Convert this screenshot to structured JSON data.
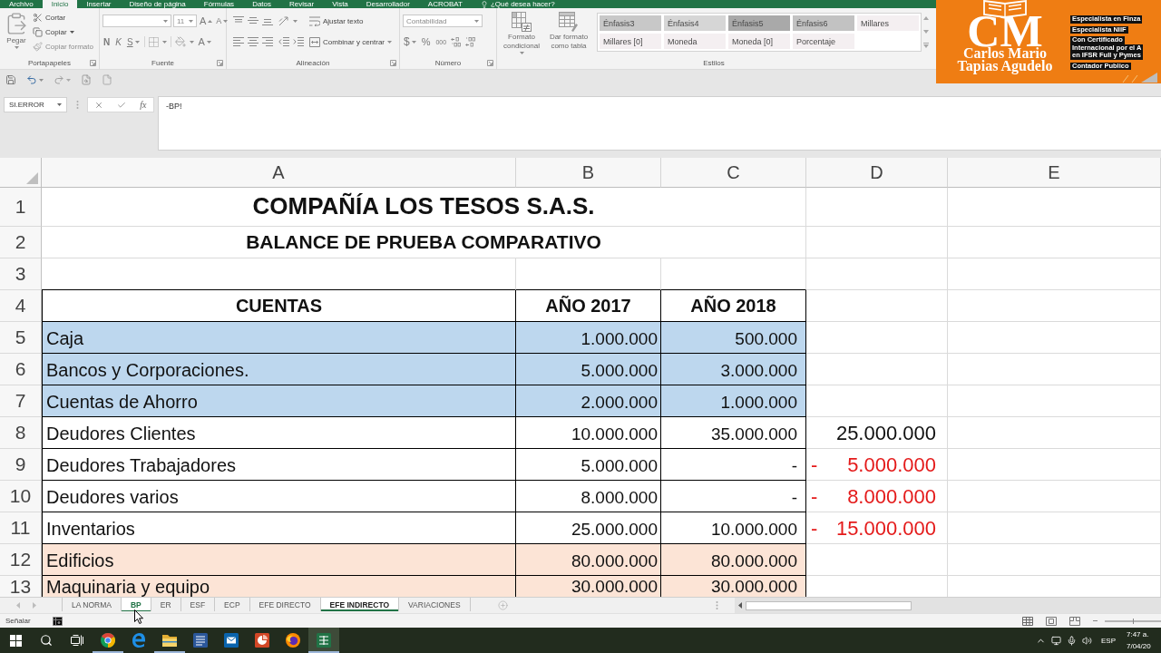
{
  "ribbon": {
    "tabs": [
      {
        "label": "Archivo",
        "selected": false
      },
      {
        "label": "Inicio",
        "selected": true
      },
      {
        "label": "Insertar",
        "selected": false
      },
      {
        "label": "Diseño de página",
        "selected": false
      },
      {
        "label": "Fórmulas",
        "selected": false
      },
      {
        "label": "Datos",
        "selected": false
      },
      {
        "label": "Revisar",
        "selected": false
      },
      {
        "label": "Vista",
        "selected": false
      },
      {
        "label": "Desarrollador",
        "selected": false
      },
      {
        "label": "ACROBAT",
        "selected": false
      }
    ],
    "tell_me": "¿Qué desea hacer?",
    "clipboard": {
      "label": "Portapapeles",
      "paste": "Pegar",
      "cut": "Cortar",
      "copy": "Copiar",
      "format_painter": "Copiar formato"
    },
    "font": {
      "label": "Fuente",
      "size": "11",
      "grow": "A",
      "shrink": "A",
      "bold": "N",
      "italic": "K",
      "underline": "S",
      "font_color": "A"
    },
    "alignment": {
      "label": "Alineación",
      "wrap_text": "Ajustar texto",
      "merge": "Combinar y centrar"
    },
    "number": {
      "label": "Número",
      "format": "Contabilidad",
      "currency": "$",
      "percent": "%",
      "thousands": "000"
    },
    "styles": {
      "label": "Estilos",
      "conditional_format": "Formato condicional",
      "format_as_table": "Dar formato como tabla",
      "gallery": [
        {
          "label": "Énfasis3",
          "color": "#c8c8c8"
        },
        {
          "label": "Énfasis4",
          "color": "#d6d6d6"
        },
        {
          "label": "Énfasis5",
          "color": "#a9a9a9"
        },
        {
          "label": "Énfasis6",
          "color": "#c2c2c2"
        },
        {
          "label": "Millares",
          "color": "#f4eff1"
        },
        {
          "label": "Millares [0]",
          "color": "#f4eff1"
        },
        {
          "label": "Moneda",
          "color": "#f4eff1"
        },
        {
          "label": "Moneda [0]",
          "color": "#f4eff1"
        },
        {
          "label": "Porcentaje",
          "color": "#f4eff1"
        }
      ]
    }
  },
  "brand": {
    "monogram": "CM",
    "name": [
      "Carlos Mario",
      "Tapias Agudelo"
    ],
    "badges": [
      {
        "lines": [
          "Especialista en Finza"
        ]
      },
      {
        "lines": [
          "Especialista NIIF"
        ]
      },
      {
        "lines": [
          "Con Certificado",
          "Internacional por el A",
          "en IFSR Full y Pymes"
        ]
      },
      {
        "lines": [
          "Contador Publico"
        ]
      }
    ]
  },
  "formula_bar": {
    "name_box": "SI.ERROR",
    "insert_function": "fx",
    "formula": "-BP!"
  },
  "sheet": {
    "columns": [
      "A",
      "B",
      "C",
      "D",
      "E"
    ],
    "rows": [
      {
        "number": "1",
        "kind": "title",
        "text": "COMPAÑÍA LOS TESOS S.A.S."
      },
      {
        "number": "2",
        "kind": "subtitle",
        "text": "BALANCE DE PRUEBA COMPARATIVO"
      },
      {
        "number": "3",
        "kind": "blank"
      },
      {
        "number": "4",
        "kind": "header",
        "cells": [
          "CUENTAS",
          "AÑO 2017",
          "AÑO 2018"
        ]
      },
      {
        "number": "5",
        "kind": "account",
        "color": "#bdd7ee",
        "account": "Caja",
        "year_2017": "1.000.000",
        "year_2018": "500.000"
      },
      {
        "number": "6",
        "kind": "account",
        "color": "#bdd7ee",
        "account": "Bancos y Corporaciones.",
        "year_2017": "5.000.000",
        "year_2018": "3.000.000"
      },
      {
        "number": "7",
        "kind": "account",
        "color": "#bdd7ee",
        "account": "Cuentas de Ahorro",
        "year_2017": "2.000.000",
        "year_2018": "1.000.000"
      },
      {
        "number": "8",
        "kind": "account",
        "account": "Deudores Clientes",
        "year_2017": "10.000.000",
        "year_2018": "35.000.000",
        "difference": {
          "value": "25.000.000",
          "negative": false
        }
      },
      {
        "number": "9",
        "kind": "account",
        "account": "Deudores Trabajadores",
        "year_2017": "5.000.000",
        "year_2018": "-",
        "difference": {
          "sign": "-",
          "value": "5.000.000",
          "negative": true
        }
      },
      {
        "number": "10",
        "kind": "account",
        "account": "Deudores varios",
        "year_2017": "8.000.000",
        "year_2018": "-",
        "difference": {
          "sign": "-",
          "value": "8.000.000",
          "negative": true
        }
      },
      {
        "number": "11",
        "kind": "account",
        "account": "Inventarios",
        "year_2017": "25.000.000",
        "year_2018": "10.000.000",
        "difference": {
          "sign": "-",
          "value": "15.000.000",
          "negative": true
        }
      },
      {
        "number": "12",
        "kind": "account",
        "color": "#fce4d6",
        "account": "Edificios",
        "year_2017": "80.000.000",
        "year_2018": "80.000.000"
      },
      {
        "number": "13",
        "kind": "account",
        "color": "#fce4d6",
        "account": "Maquinaria y equipo",
        "year_2017": "30.000.000",
        "year_2018": "30.000.000"
      }
    ]
  },
  "sheet_tabs": [
    {
      "label": "LA NORMA",
      "selected": false,
      "formula_origin": false
    },
    {
      "label": "BP",
      "selected": true,
      "formula_origin": false
    },
    {
      "label": "ER",
      "selected": false,
      "formula_origin": false
    },
    {
      "label": "ESF",
      "selected": false,
      "formula_origin": false
    },
    {
      "label": "ECP",
      "selected": false,
      "formula_origin": false
    },
    {
      "label": "EFE DIRECTO",
      "selected": false,
      "formula_origin": false
    },
    {
      "label": "EFE INDIRECTO",
      "selected": false,
      "formula_origin": true
    },
    {
      "label": "VARIACIONES",
      "selected": false,
      "formula_origin": false
    }
  ],
  "status_bar": {
    "mode": "Señalar"
  },
  "taskbar": {
    "apps": [
      {
        "running": true,
        "selected": false
      },
      {
        "running": false,
        "selected": false
      },
      {
        "running": true,
        "selected": false
      },
      {
        "running": false,
        "selected": false
      },
      {
        "running": false,
        "selected": false
      },
      {
        "running": false,
        "selected": false
      },
      {
        "running": false,
        "selected": false
      },
      {
        "running": true,
        "selected": true
      }
    ],
    "language": "ESP",
    "time": "7:47 a.",
    "date": "7/04/20"
  }
}
